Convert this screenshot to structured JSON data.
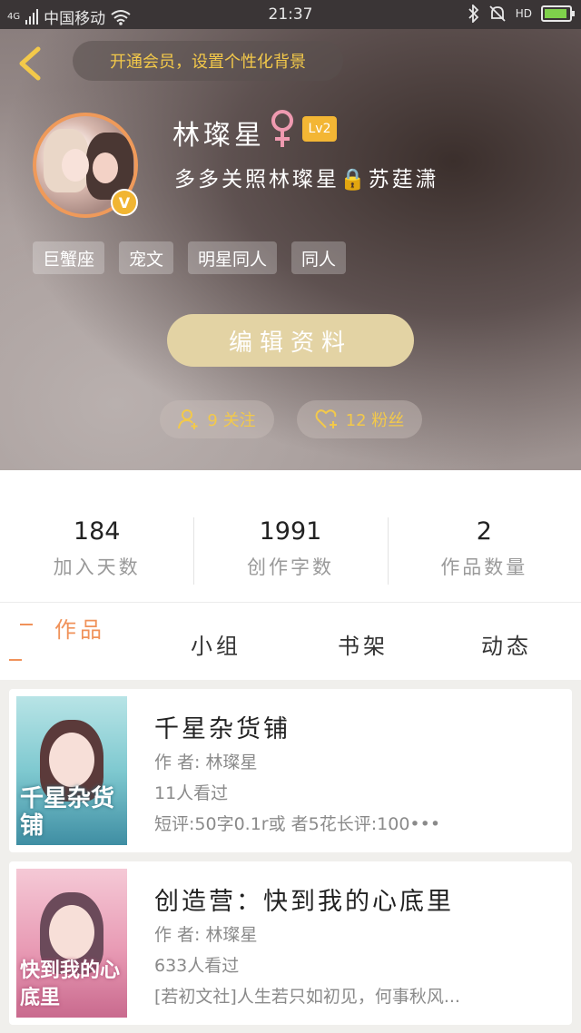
{
  "status_bar": {
    "network": "4G",
    "carrier": "中国移动",
    "time": "21:37",
    "hd_label": "HD"
  },
  "header": {
    "vip_banner": "开通会员，设置个性化背景",
    "username": "林璨星",
    "level": "Lv2",
    "signature": "多多关照林璨星🔒苏莛潇",
    "tags": [
      "巨蟹座",
      "宠文",
      "明星同人",
      "同人"
    ],
    "edit_button": "编辑资料",
    "following": "9 关注",
    "fans": "12 粉丝",
    "colors": {
      "accent": "#f3c94a",
      "edit_button": "#e3d3a4",
      "avatar_ring": "#ef9a5a"
    }
  },
  "stats": [
    {
      "value": "184",
      "label": "加入天数"
    },
    {
      "value": "1991",
      "label": "创作字数"
    },
    {
      "value": "2",
      "label": "作品数量"
    }
  ],
  "tabs": [
    {
      "label": "作品",
      "active": true
    },
    {
      "label": "小组",
      "active": false
    },
    {
      "label": "书架",
      "active": false
    },
    {
      "label": "动态",
      "active": false
    }
  ],
  "works": [
    {
      "title": "千星杂货铺",
      "author": "作 者: 林璨星",
      "views": "11人看过",
      "desc": "短评:50字0.1r或 者5花长评:100•••",
      "cover_text": "千星杂货铺"
    },
    {
      "title": "创造营：快到我的心底里",
      "author": "作 者: 林璨星",
      "views": "633人看过",
      "desc": "[若初文社]人生若只如初见，何事秋风...",
      "cover_text": "快到我的心底里"
    }
  ]
}
